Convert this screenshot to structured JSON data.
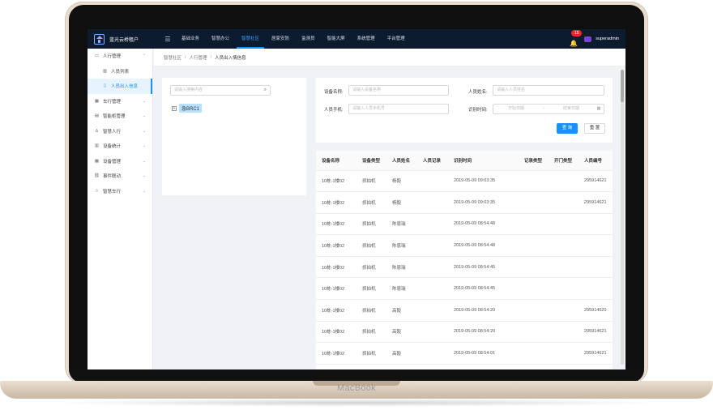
{
  "device": {
    "brand": "MacBook"
  },
  "app": {
    "logo_text": "蓝光云桥租户",
    "nav": [
      "基础业务",
      "智慧办公",
      "智慧社区",
      "居家安防",
      "监测员",
      "智能大屏",
      "系统管理",
      "平台管理"
    ],
    "active_nav": "智慧社区",
    "notification_count": "15",
    "username": "superadmin"
  },
  "sidebar": {
    "items": [
      {
        "label": "人行管理",
        "icon": "monitor-icon",
        "expanded": true
      },
      {
        "label": "人员列表",
        "icon": "chart-icon",
        "sub": true
      },
      {
        "label": "人员出入信息",
        "icon": "doc-icon",
        "sub": true,
        "active": true
      },
      {
        "label": "车行管理",
        "icon": "grid-icon"
      },
      {
        "label": "智能柜管理",
        "icon": "cabinet-icon"
      },
      {
        "label": "智慧人行",
        "icon": "user-icon"
      },
      {
        "label": "设备统计",
        "icon": "chart-icon"
      },
      {
        "label": "设备管理",
        "icon": "grid-icon"
      },
      {
        "label": "事件联动",
        "icon": "link-icon"
      },
      {
        "label": "智慧车行",
        "icon": "star-icon"
      }
    ]
  },
  "breadcrumb": [
    "智慧社区",
    "人行管理",
    "人员出入情信息"
  ],
  "tree": {
    "search_placeholder": "请输入搜索内容",
    "node_label": "急BRC1"
  },
  "filters": {
    "device_name_label": "设备名称:",
    "device_name_placeholder": "请输入设备名称",
    "person_name_label": "人员姓名:",
    "person_name_placeholder": "请输入人员姓名",
    "phone_label": "人员手机:",
    "phone_placeholder": "请输入人员手机号",
    "time_label": "识别时间:",
    "start_placeholder": "开始日期",
    "range_sep": "~",
    "end_placeholder": "结束日期",
    "search_button": "查 询",
    "reset_button": "重 置"
  },
  "table": {
    "columns": [
      "设备名称",
      "设备类型",
      "人员姓名",
      "人员记录",
      "识别时间",
      "记录类型",
      "开门类型",
      "人员编号"
    ],
    "rows": [
      [
        "10栋-1楼02",
        "抓拍机",
        "杨毅",
        "",
        "2019-05-09 09:03:35",
        "",
        "",
        "295914621"
      ],
      [
        "10栋-1楼02",
        "抓拍机",
        "杨毅",
        "",
        "2019-05-09 09:03:35",
        "",
        "",
        "295914621"
      ],
      [
        "10栋-1楼02",
        "抓拍机",
        "陈恩瑞",
        "",
        "2019-05-09 08:54:48",
        "",
        "",
        ""
      ],
      [
        "10栋-1楼02",
        "抓拍机",
        "陈恩瑞",
        "",
        "2019-05-09 08:54:48",
        "",
        "",
        ""
      ],
      [
        "10栋-1楼02",
        "抓拍机",
        "陈恩瑞",
        "",
        "2019-05-09 08:54:45",
        "",
        "",
        ""
      ],
      [
        "10栋-1楼02",
        "抓拍机",
        "陈恩瑞",
        "",
        "2019-05-09 08:54:45",
        "",
        "",
        ""
      ],
      [
        "10栋-1楼02",
        "抓拍机",
        "高毅",
        "",
        "2019-05-09 08:54:20",
        "",
        "",
        "295914620"
      ],
      [
        "10栋-1楼02",
        "抓拍机",
        "高毅",
        "",
        "2019-05-09 08:54:20",
        "",
        "",
        "295914621"
      ],
      [
        "10栋-1楼02",
        "抓拍机",
        "高毅",
        "",
        "2019-05-09 08:54:01",
        "",
        "",
        "295914621"
      ]
    ]
  },
  "colors": {
    "primary": "#1890ff",
    "topbar": "#0c1b2e",
    "badge": "#f5222d"
  }
}
